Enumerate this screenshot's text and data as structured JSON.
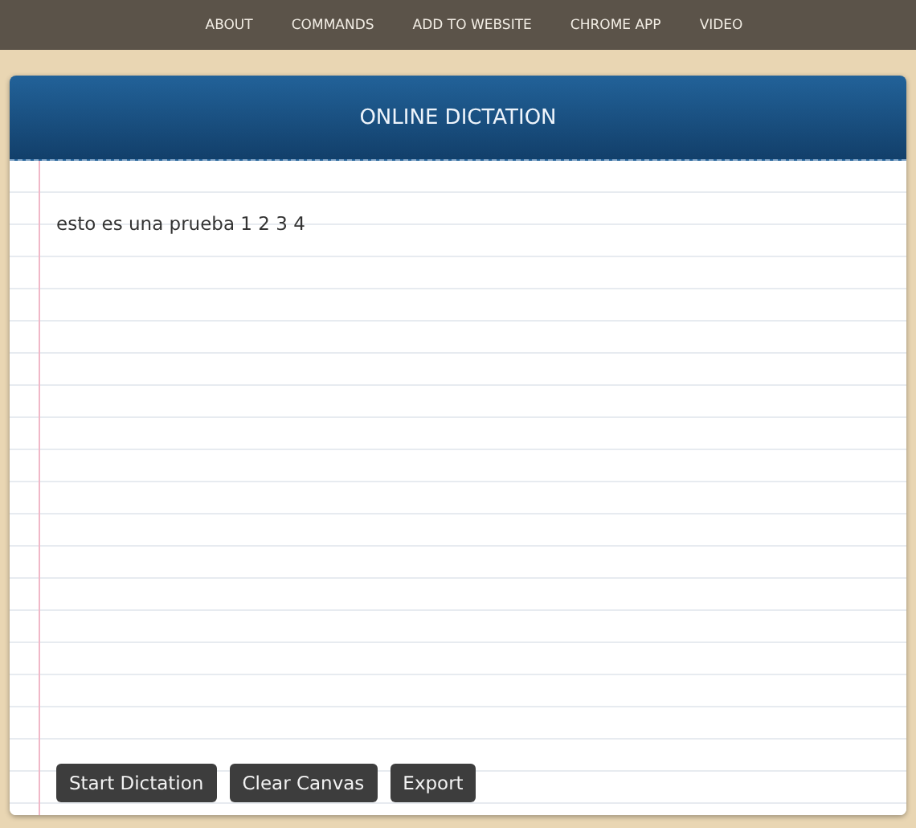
{
  "nav": [
    "ABOUT",
    "COMMANDS",
    "ADD TO WEBSITE",
    "CHROME APP",
    "VIDEO"
  ],
  "header": {
    "title": "ONLINE DICTATION"
  },
  "canvas": {
    "text": "esto es una prueba 1 2 3 4"
  },
  "buttons": [
    "Start Dictation",
    "Clear Canvas",
    "Export"
  ]
}
